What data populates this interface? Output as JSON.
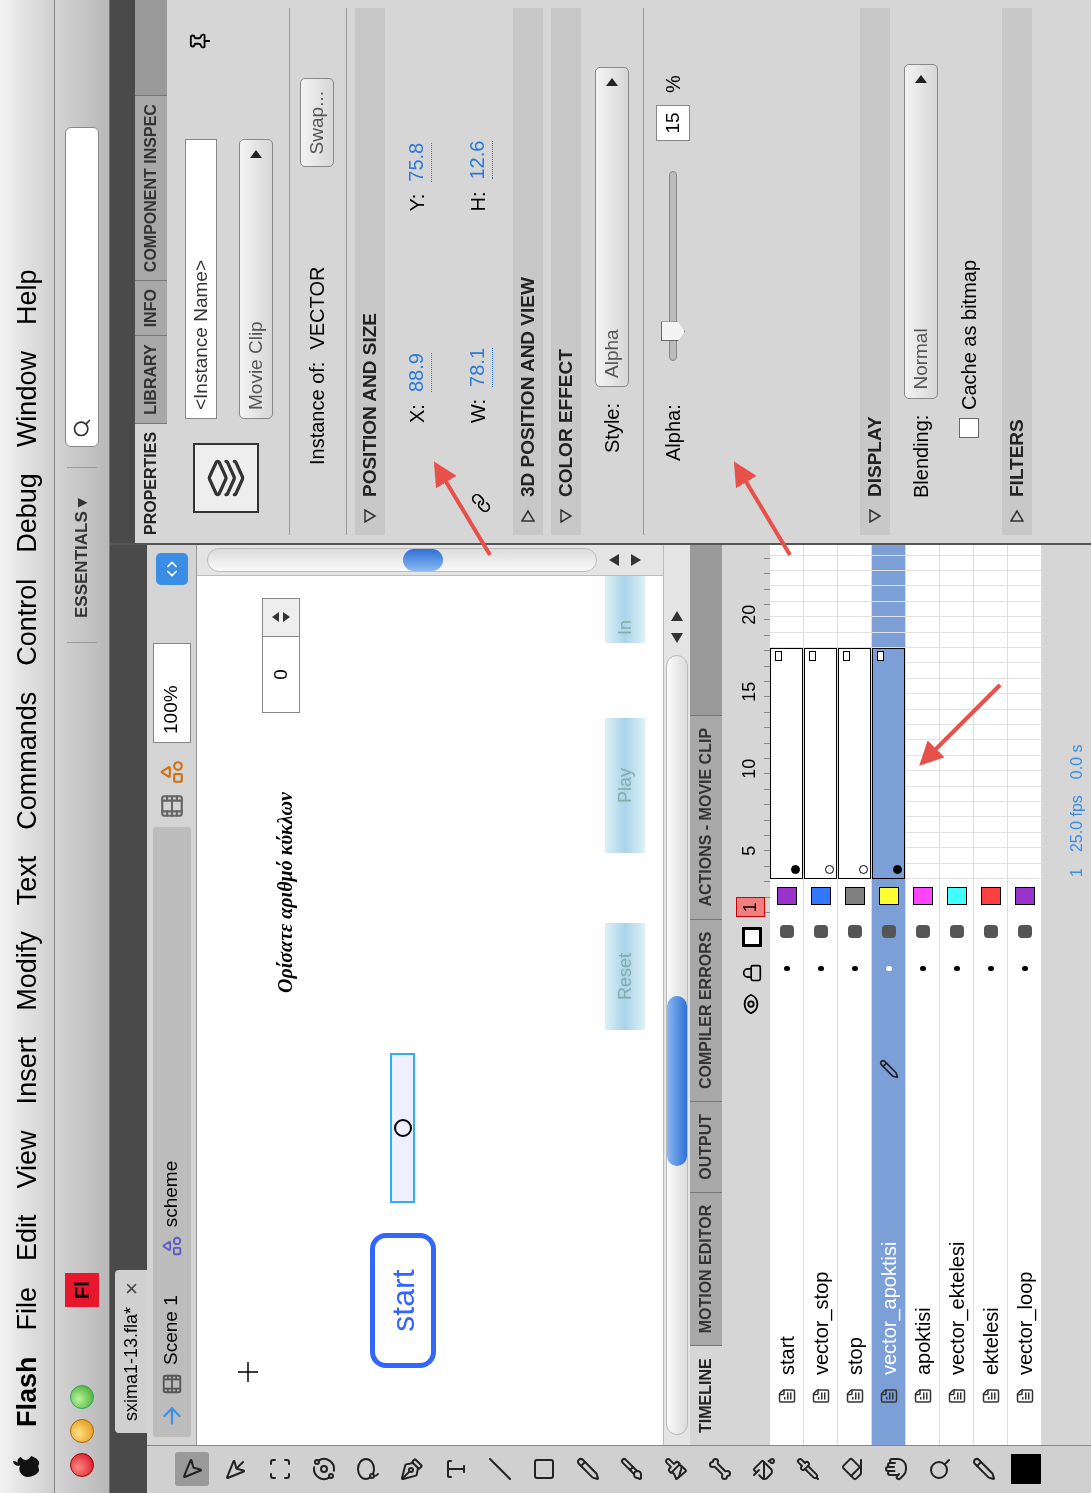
{
  "menu_bar": {
    "items": [
      "Flash",
      "File",
      "Edit",
      "View",
      "Insert",
      "Modify",
      "Text",
      "Commands",
      "Control",
      "Debug",
      "Window",
      "Help"
    ]
  },
  "app_bar": {
    "logo": "Fl",
    "workspace": "ESSENTIALS ▾"
  },
  "document_tab": {
    "title": "sxima1-13.fla*",
    "close": "×"
  },
  "edit_bar": {
    "scene": "Scene 1",
    "symbol": "scheme",
    "zoom": "100%"
  },
  "stage": {
    "caption": "Ορίσατε αριθμό κύκλων",
    "counter": "0",
    "start_label": "start",
    "buttons": [
      "Reset",
      "Play",
      "In"
    ]
  },
  "timeline": {
    "tabs": [
      {
        "label": "TIMELINE",
        "selected": true
      },
      {
        "label": "MOTION EDITOR",
        "selected": false
      },
      {
        "label": "OUTPUT",
        "selected": false
      },
      {
        "label": "COMPILER ERRORS",
        "selected": false
      },
      {
        "label": "ACTIONS - MOVIE CLIP",
        "selected": false
      }
    ],
    "ruler": [
      "1",
      "5",
      "10",
      "15",
      "20"
    ],
    "layers": [
      {
        "name": "start",
        "color": "#9933cc",
        "selected": false,
        "frames": true,
        "filled_keyframe": true
      },
      {
        "name": "vector_stop",
        "color": "#3377ff",
        "selected": false,
        "frames": true,
        "filled_keyframe": false
      },
      {
        "name": "stop",
        "color": "#808080",
        "selected": false,
        "frames": true,
        "filled_keyframe": false
      },
      {
        "name": "vector_apoktisi",
        "color": "#ffff33",
        "selected": true,
        "frames": true,
        "filled_keyframe": true
      },
      {
        "name": "apoktisi",
        "color": "#ff44ff",
        "selected": false,
        "frames": false
      },
      {
        "name": "vector_ektelesi",
        "color": "#44ffff",
        "selected": false,
        "frames": false
      },
      {
        "name": "ektelesi",
        "color": "#ff4040",
        "selected": false,
        "frames": false
      },
      {
        "name": "vector_loop",
        "color": "#9933cc",
        "selected": false,
        "frames": false
      }
    ],
    "status": [
      "1",
      "25.0 fps",
      "0.0 s"
    ]
  },
  "properties": {
    "tabs": [
      {
        "label": "PROPERTIES",
        "selected": true
      },
      {
        "label": "LIBRARY",
        "selected": false
      },
      {
        "label": "INFO",
        "selected": false
      },
      {
        "label": "COMPONENT INSPEC",
        "selected": false
      }
    ],
    "instance_name": {
      "placeholder": "<Instance Name>"
    },
    "symbol_type": "Movie Clip",
    "instance_of_label": "Instance of:",
    "instance_of": "VECTOR",
    "swap": "Swap...",
    "sections": [
      {
        "title": "POSITION AND SIZE",
        "expanded": true,
        "kind": "position"
      },
      {
        "title": "3D POSITION AND VIEW",
        "expanded": false,
        "kind": "empty"
      },
      {
        "title": "COLOR EFFECT",
        "expanded": true,
        "kind": "color"
      },
      {
        "title": "DISPLAY",
        "expanded": true,
        "kind": "display"
      },
      {
        "title": "FILTERS",
        "expanded": false,
        "kind": "empty"
      }
    ],
    "position": [
      {
        "label": "X:",
        "value": "88.9"
      },
      {
        "label": "Y:",
        "value": "75.8"
      },
      {
        "label": "W:",
        "value": "78.1"
      },
      {
        "label": "H:",
        "value": "12.6"
      }
    ],
    "color": {
      "style_label": "Style:",
      "style": "Alpha",
      "alpha_label": "Alpha:",
      "level": 0.15,
      "alpha": "15",
      "unit": "%"
    },
    "display": {
      "blending_label": "Blending:",
      "blending": "Normal",
      "cache_label": "Cache as bitmap",
      "checked": false
    }
  }
}
